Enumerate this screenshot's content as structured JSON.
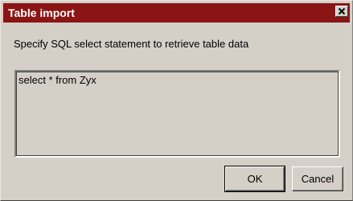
{
  "window": {
    "title": "Table import",
    "close_icon": "close-icon",
    "title_bar_color": "#8b1414"
  },
  "prompt": {
    "text": "Specify SQL select statement to retrieve table data"
  },
  "sql_input": {
    "value": "select * from Zyx"
  },
  "buttons": {
    "ok_label": "OK",
    "cancel_label": "Cancel"
  }
}
